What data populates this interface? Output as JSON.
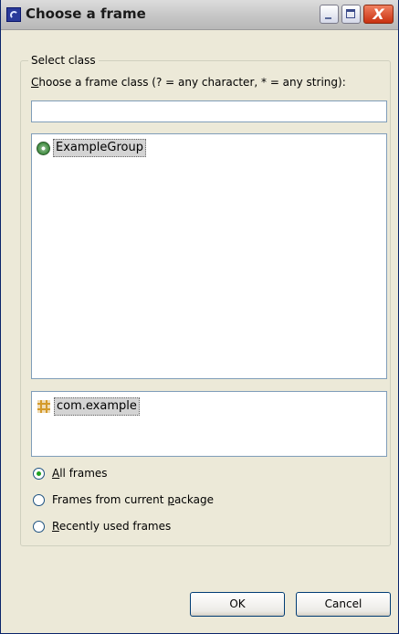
{
  "window": {
    "title": "Choose a frame",
    "close_glyph": "X"
  },
  "group": {
    "legend": "Select class",
    "prompt_mnemonic": "C",
    "prompt_rest": "hoose a frame class (? = any character, * = any string):"
  },
  "filter": {
    "value": "",
    "placeholder": ""
  },
  "class_list": {
    "items": [
      {
        "label": "ExampleGroup",
        "icon": "frame-class-icon"
      }
    ]
  },
  "package_list": {
    "items": [
      {
        "label": "com.example",
        "icon": "package-icon"
      }
    ]
  },
  "radios": [
    {
      "pre": "",
      "mnemonic": "A",
      "post": "ll frames",
      "checked": true
    },
    {
      "pre": "Frames from current ",
      "mnemonic": "p",
      "post": "ackage",
      "checked": false
    },
    {
      "pre": "",
      "mnemonic": "R",
      "post": "ecently used frames",
      "checked": false
    }
  ],
  "buttons": {
    "ok": "OK",
    "cancel": "Cancel"
  }
}
